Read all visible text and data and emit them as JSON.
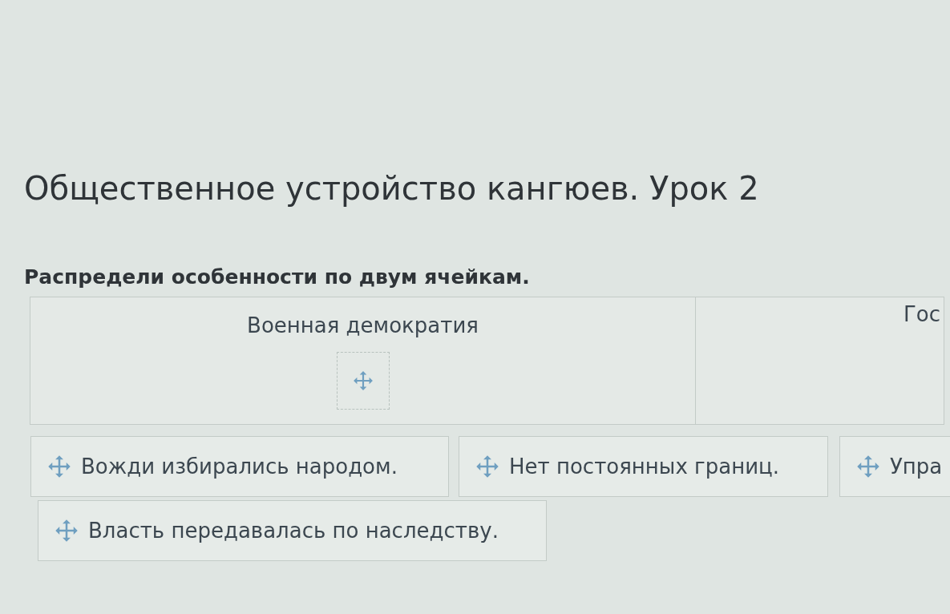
{
  "title": "Общественное устройство кангюев. Урок 2",
  "instruction": "Распредели особенности по двум ячейкам.",
  "columns": [
    {
      "header": "Военная демократия",
      "drop_slot": true
    },
    {
      "header": "Гос",
      "drop_slot": false
    }
  ],
  "cards": [
    {
      "text": "Вожди избирались народом."
    },
    {
      "text": "Нет постоянных границ."
    },
    {
      "text": "Упра"
    },
    {
      "text": "Власть передавалась по наследству."
    }
  ]
}
